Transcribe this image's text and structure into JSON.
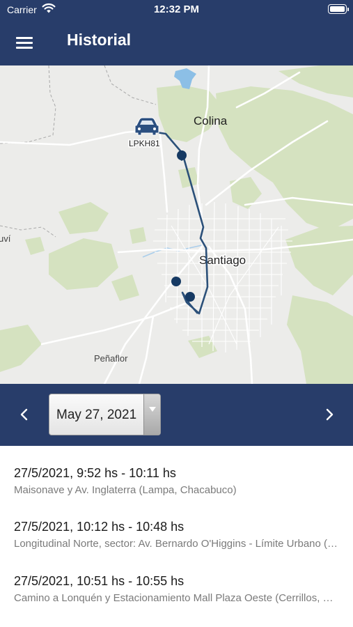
{
  "status_bar": {
    "carrier": "Carrier",
    "time": "12:32 PM",
    "wifi_icon": "wifi-icon",
    "battery_icon": "battery-icon"
  },
  "nav": {
    "title": "Historial",
    "menu_icon": "hamburger-menu-icon",
    "background": "#283d6a"
  },
  "map": {
    "labels": {
      "colina": "Colina",
      "santiago": "Santiago",
      "penaflor": "Peñaflor",
      "edge": "uví"
    },
    "vehicle": {
      "plate": "LPKH81",
      "icon": "car-icon"
    },
    "route_color": "#2b5079",
    "marker_color": "#163a63"
  },
  "date_nav": {
    "selected_date": "May 27, 2021",
    "prev_icon": "chevron-left-icon",
    "next_icon": "chevron-right-icon",
    "dropdown_icon": "triangle-down-icon"
  },
  "trips": [
    {
      "time": "27/5/2021, 9:52 hs - 10:11 hs",
      "address": "Maisonave y Av. Inglaterra (Lampa, Chacabuco)"
    },
    {
      "time": "27/5/2021, 10:12 hs - 10:48 hs",
      "address": "Longitudinal Norte, sector: Av. Bernardo O'Higgins - Límite Urbano (Colina, Chacabuco)"
    },
    {
      "time": "27/5/2021, 10:51 hs - 10:55 hs",
      "address": "Camino a Lonquén y Estacionamiento Mall Plaza Oeste (Cerrillos, Santiago)"
    }
  ]
}
